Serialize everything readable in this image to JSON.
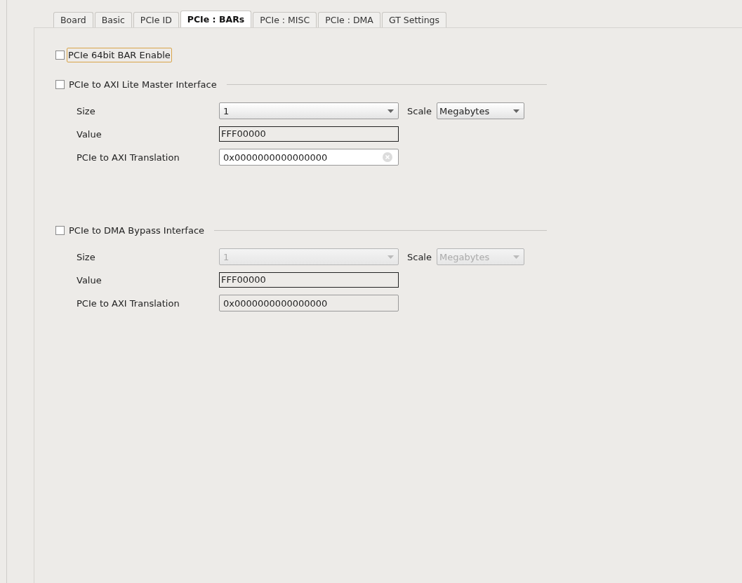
{
  "tabs": [
    {
      "label": "Board",
      "selected": false
    },
    {
      "label": "Basic",
      "selected": false
    },
    {
      "label": "PCIe ID",
      "selected": false
    },
    {
      "label": "PCIe : BARs",
      "selected": true
    },
    {
      "label": "PCIe : MISC",
      "selected": false
    },
    {
      "label": "PCIe : DMA",
      "selected": false
    },
    {
      "label": "GT Settings",
      "selected": false
    }
  ],
  "option": {
    "label": "PCIe 64bit BAR Enable",
    "checked": false,
    "focused": true
  },
  "sections": [
    {
      "title": "PCIe to AXI Lite Master Interface",
      "checked": false,
      "enabled": true,
      "size_label": "Size",
      "size": "1",
      "scale_label": "Scale",
      "scale": "Megabytes",
      "value_label": "Value",
      "value": "FFF00000",
      "translation_label": "PCIe to AXI Translation",
      "translation": "0x0000000000000000"
    },
    {
      "title": "PCIe to DMA Bypass Interface",
      "checked": false,
      "enabled": false,
      "size_label": "Size",
      "size": "1",
      "scale_label": "Scale",
      "scale": "Megabytes",
      "value_label": "Value",
      "value": "FFF00000",
      "translation_label": "PCIe to AXI Translation",
      "translation": "0x0000000000000000"
    }
  ]
}
